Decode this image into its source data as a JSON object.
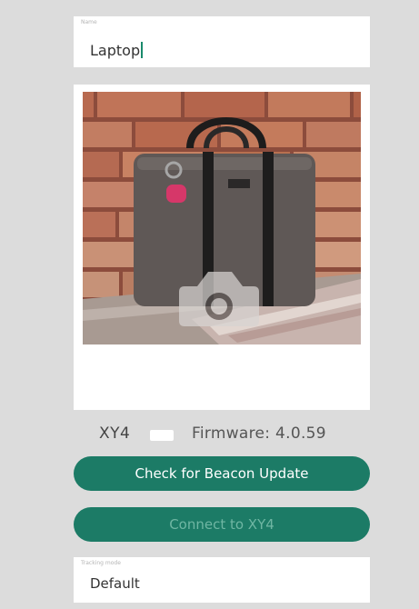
{
  "name_field": {
    "label": "Name",
    "value": "Laptop"
  },
  "photo": {
    "icon": "camera-icon"
  },
  "device": {
    "name": "XY4",
    "firmware": "Firmware: 4.0.59"
  },
  "buttons": {
    "check_update": "Check for Beacon Update",
    "connect": "Connect to XY4"
  },
  "mode_field": {
    "label": "Tracking mode",
    "value": "Default"
  },
  "colors": {
    "background": "#dcdcdc",
    "accent": "#1c7b66",
    "disabled_text": "#6fb6a3"
  }
}
